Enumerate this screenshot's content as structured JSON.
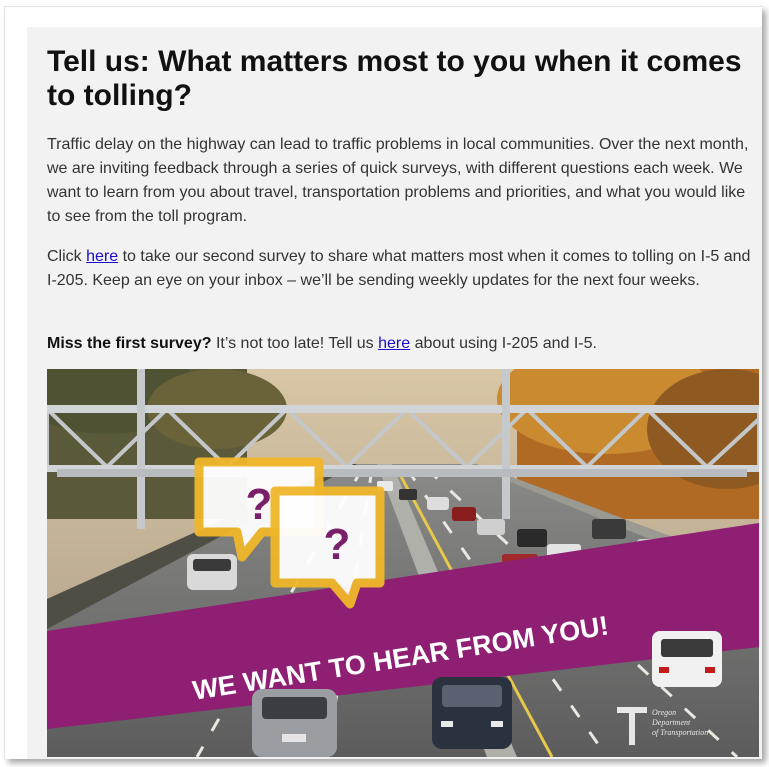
{
  "article": {
    "title": "Tell us: What matters most to you when it comes to tolling?",
    "intro": "Traffic delay on the highway can lead to traffic problems in local communities. Over the next month, we are inviting feedback through a series of quick surveys, with different questions each week. We want to learn from you about travel, transportation problems and priorities, and what you would like to see from the toll program.",
    "survey2": {
      "before": "Click ",
      "link": "here",
      "after": " to take our second survey to share what matters most when it comes to tolling on I-5 and I-205. Keep an eye on your inbox – we’ll be sending weekly updates for the next four weeks."
    },
    "survey1": {
      "bold": "Miss the first survey?",
      "before": " It’s not too late! Tell us ",
      "link": "here",
      "after": " about using I-205 and I-5."
    }
  },
  "hero": {
    "banner_text": "WE WANT TO HEAR FROM YOU!",
    "question_mark": "?",
    "logo_lines": [
      "Oregon",
      "Department",
      "of Transportation"
    ],
    "icon": "speech-bubbles-icon",
    "colors": {
      "banner": "#8e1f72",
      "bubble_border": "#f0b72a",
      "question": "#7a1f6a",
      "sky": "#c9b79a",
      "foliage": "#c07a2a",
      "road": "#6b6b6b",
      "gantry": "#bfc3c6"
    }
  }
}
